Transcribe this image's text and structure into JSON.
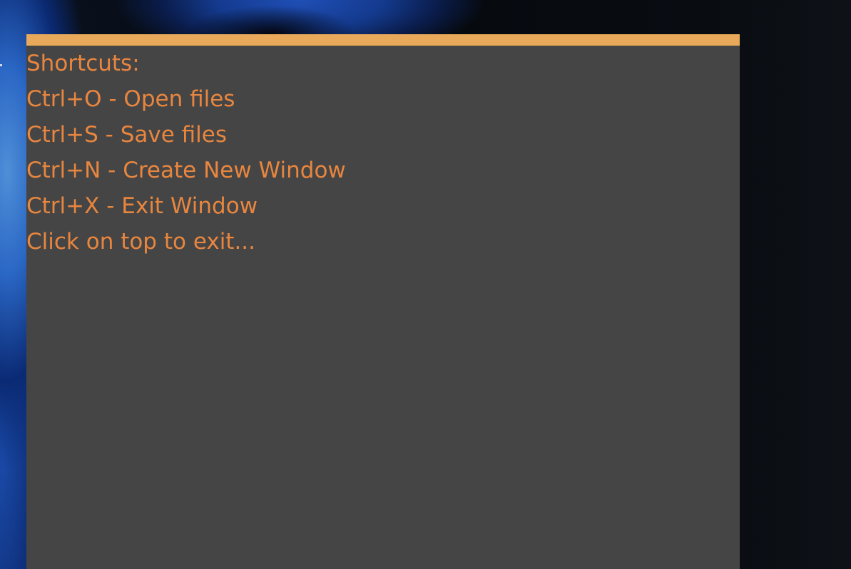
{
  "panel": {
    "title_line": "Shortcuts:",
    "lines": [
      "Ctrl+O - Open files",
      "Ctrl+S - Save files",
      "Ctrl+N - Create New Window",
      "Ctrl+X - Exit Window",
      "Click on top to exit..."
    ],
    "colors": {
      "topbar": "#e8a95a",
      "background": "#454545",
      "text": "#e8863f"
    }
  },
  "desktop": {
    "wallpaper": "blue-hooded-figure"
  }
}
